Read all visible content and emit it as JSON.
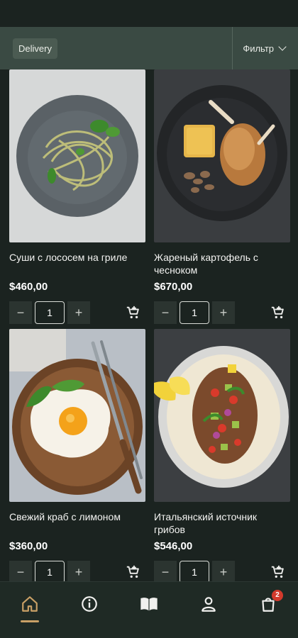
{
  "header": {
    "delivery_label": "Delivery",
    "filter_label": "Фильтр"
  },
  "products": [
    {
      "name": "Суши с лососем на гриле",
      "price": "$460,00",
      "qty": "1"
    },
    {
      "name": "Жареный картофель с чесноком",
      "price": "$670,00",
      "qty": "1"
    },
    {
      "name": "Свежий краб с лимоном",
      "price": "$360,00",
      "qty": "1"
    },
    {
      "name": "Итальянский источник грибов",
      "price": "$546,00",
      "qty": "1"
    }
  ],
  "controls": {
    "minus": "−",
    "plus": "+"
  },
  "bottom_nav": {
    "items": [
      "home-icon",
      "info-icon",
      "menu-book-icon",
      "profile-icon",
      "cart-icon"
    ],
    "cart_badge": "2",
    "accent": "#c9a066"
  }
}
